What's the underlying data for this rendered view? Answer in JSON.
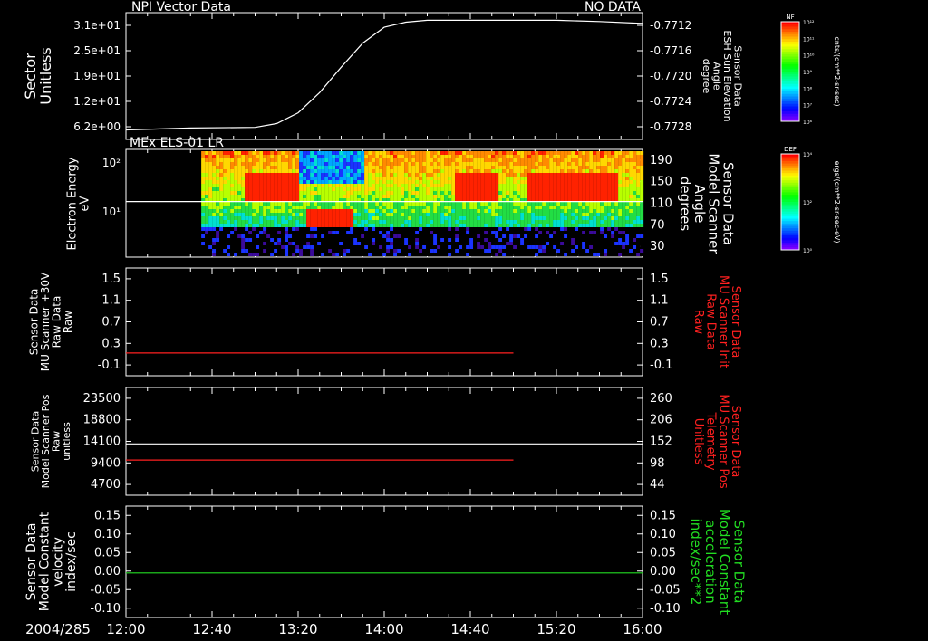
{
  "colors": {
    "background": "#000000",
    "foreground": "#ffffff",
    "red": "#ff2020",
    "green": "#22dd22"
  },
  "x_axis": {
    "start_label": "2004/285",
    "ticks": [
      "12:00",
      "12:40",
      "13:20",
      "14:00",
      "14:40",
      "15:20",
      "16:00"
    ]
  },
  "chart_data": [
    {
      "type": "line",
      "panel": 1,
      "title": "NPI Vector Data",
      "status": "NO DATA",
      "ylabel_left": [
        "Sector",
        "Unitless"
      ],
      "left_ticks": [
        "3.1e+01",
        "2.5e+01",
        "1.9e+01",
        "1.2e+01",
        "6.2e+00"
      ],
      "ylabel_right": [
        "Sensor Data",
        "ESH Sun Elevation",
        "Angle",
        "degree"
      ],
      "right_ticks": [
        "-0.7712",
        "-0.7716",
        "-0.7720",
        "-0.7724",
        "-0.7728"
      ],
      "right_ylim": [
        -0.7731,
        -0.7711
      ],
      "series": [
        {
          "color": "#ffffff",
          "x": [
            "12:00",
            "12:30",
            "13:00",
            "13:10",
            "13:20",
            "13:30",
            "13:40",
            "13:50",
            "14:00",
            "14:10",
            "14:20",
            "14:40",
            "15:00",
            "15:20",
            "15:40",
            "16:00"
          ],
          "y": [
            -0.77295,
            -0.77292,
            -0.77291,
            -0.77285,
            -0.77268,
            -0.77236,
            -0.77196,
            -0.77158,
            -0.77133,
            -0.77125,
            -0.77122,
            -0.77122,
            -0.77122,
            -0.77122,
            -0.77124,
            -0.77127
          ]
        }
      ]
    },
    {
      "type": "heatmap",
      "panel": 2,
      "title": "MEx ELS-01 LR",
      "ylabel_left": [
        "Electron Energy",
        "eV"
      ],
      "left_ticks": [
        "10²",
        "10¹"
      ],
      "ylabel_right": [
        "Sensor Data",
        "Model Scanner",
        "Angle",
        "degrees"
      ],
      "right_ticks": [
        "190",
        "150",
        "110",
        "70",
        "30"
      ],
      "right_ylim": [
        0,
        190
      ],
      "data_start": "12:35",
      "overlay_line": {
        "axis": "right",
        "value": 98,
        "color": "#ffffff"
      },
      "colorbar": {
        "label": "DEF",
        "units": "ergs/(cm**2-sr-sec-eV)",
        "top": "10⁴",
        "mid": "10²",
        "bottom": "10⁰"
      }
    },
    {
      "type": "line",
      "panel": 3,
      "ylabel_left": [
        "Sensor Data",
        "MU Scanner +30V",
        "Raw Data",
        "Raw"
      ],
      "left_ticks": [
        "1.5",
        "1.1",
        "0.7",
        "0.3",
        "-0.1"
      ],
      "left_ylim": [
        -0.4,
        1.5
      ],
      "ylabel_right": [
        "Sensor Data",
        "MU Scanner Init",
        "Raw Data",
        "Raw"
      ],
      "right_ticks": [
        "1.5",
        "1.1",
        "0.7",
        "0.3",
        "-0.1"
      ],
      "right_color": "#ff2020",
      "series": [
        {
          "color": "#ff2020",
          "x": [
            "12:00",
            "15:00"
          ],
          "y": [
            0.0,
            0.0
          ]
        }
      ]
    },
    {
      "type": "line",
      "panel": 4,
      "ylabel_left": [
        "Sensor Data",
        "Model Scanner Pos",
        "Raw",
        "unitless"
      ],
      "left_ticks": [
        "23500",
        "18800",
        "14100",
        "9400",
        "4700"
      ],
      "left_ylim": [
        0,
        23500
      ],
      "ylabel_right": [
        "Sensor Data",
        "MU Scanner Pos",
        "Telemetry",
        "Unitless"
      ],
      "right_ticks": [
        "260",
        "206",
        "152",
        "98",
        "44"
      ],
      "right_ylim": [
        0,
        260
      ],
      "right_color": "#ff2020",
      "series": [
        {
          "color": "#ffffff",
          "axis": "left",
          "x": [
            "12:00",
            "16:00"
          ],
          "y": [
            11200,
            11200
          ]
        },
        {
          "color": "#ff2020",
          "axis": "right",
          "x": [
            "12:00",
            "15:00"
          ],
          "y": [
            85,
            85
          ]
        }
      ]
    },
    {
      "type": "line",
      "panel": 5,
      "ylabel_left": [
        "Sensor Data",
        "Model Constant",
        "velocity",
        "index/sec"
      ],
      "left_ticks": [
        "0.15",
        "0.10",
        "0.05",
        "0.00",
        "-0.05",
        "-0.10"
      ],
      "left_ylim": [
        -0.1,
        0.15
      ],
      "ylabel_right": [
        "Sensor Data",
        "Model Constant",
        "acceleration",
        "index/sec**2"
      ],
      "right_ticks": [
        "0.15",
        "0.10",
        "0.05",
        "0.00",
        "-0.05",
        "-0.10"
      ],
      "right_color": "#22dd22",
      "series": [
        {
          "color": "#22dd22",
          "x": [
            "12:00",
            "16:00"
          ],
          "y": [
            0.0,
            0.0
          ]
        }
      ]
    }
  ],
  "colorbars": [
    {
      "label": "NF",
      "units": "cnts/(cm**2-sr-sec)",
      "top": "10¹²",
      "ticks": [
        "10¹²",
        "10¹¹",
        "10¹⁰",
        "10⁹",
        "10⁸",
        "10⁷",
        "10⁶"
      ],
      "bottom": "10⁶"
    },
    {
      "label": "DEF",
      "units": "ergs/(cm**2-sr-sec-eV)",
      "top": "10⁴",
      "ticks": [
        "10⁴",
        "10²",
        "10⁰"
      ],
      "bottom": "10⁰"
    }
  ]
}
